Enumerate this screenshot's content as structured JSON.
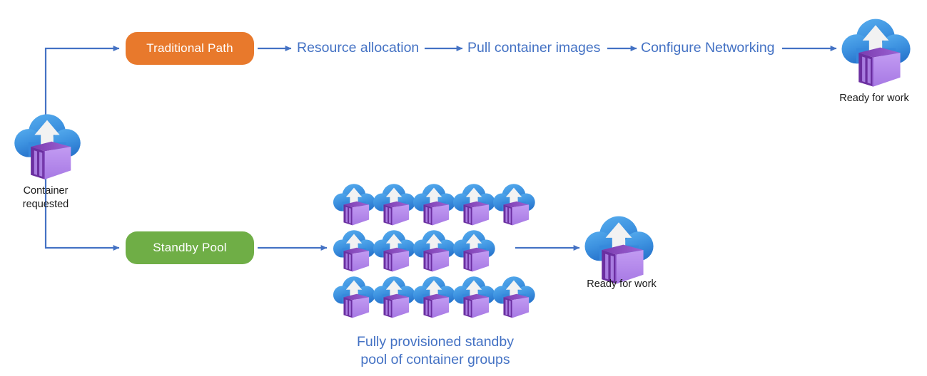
{
  "diagram": {
    "title": "Azure Container Instances standby pool flow",
    "background": "#ffffff"
  },
  "colors": {
    "traditional_pill": "#E8792C",
    "standby_pill": "#6FAE46",
    "connector_blue": "#4472C4",
    "step_text": "#4472C4",
    "caption_text": "#1a1a1a",
    "cloud_blue_light": "#4FA6EA",
    "cloud_blue_dark": "#2E7CD6",
    "container_purple_light": "#B municipal",
    "container_purple": "#B184E8",
    "container_purple_dark": "#6B2FA0"
  },
  "source_node": {
    "icon": "azure-container-instance-icon",
    "caption": "Container\nrequested"
  },
  "branches": {
    "traditional": {
      "pill_label": "Traditional Path",
      "steps": [
        "Resource allocation",
        "Pull container images",
        "Configure Networking"
      ],
      "result": {
        "icon": "azure-container-instance-icon",
        "caption": "Ready for work"
      }
    },
    "standby": {
      "pill_label": "Standby Pool",
      "pool": {
        "caption": "Fully provisioned standby\npool of container groups",
        "rows": [
          5,
          4,
          5
        ],
        "total_icons": 14,
        "icon": "azure-container-instance-icon"
      },
      "result": {
        "icon": "azure-container-instance-icon",
        "caption": "Ready for work"
      }
    }
  },
  "connectors": [
    {
      "name": "source-to-traditional",
      "style": "elbow-up-arrow"
    },
    {
      "name": "source-to-standby",
      "style": "elbow-down-arrow"
    },
    {
      "name": "traditional-to-resource",
      "style": "straight-arrow"
    },
    {
      "name": "resource-to-pull",
      "style": "straight-arrow"
    },
    {
      "name": "pull-to-configure",
      "style": "straight-arrow"
    },
    {
      "name": "configure-to-ready",
      "style": "straight-arrow"
    },
    {
      "name": "standby-to-pool",
      "style": "straight-arrow"
    },
    {
      "name": "pool-to-ready",
      "style": "straight-arrow"
    }
  ]
}
